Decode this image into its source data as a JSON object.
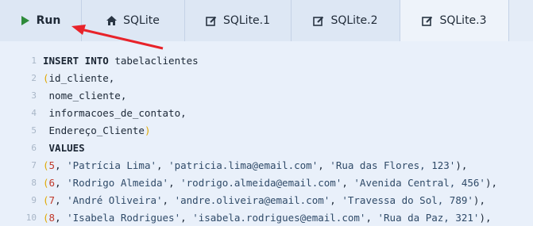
{
  "tabs": {
    "run": {
      "label": "Run",
      "icon": "play-icon"
    },
    "items": [
      {
        "label": "SQLite",
        "icon": "home-icon"
      },
      {
        "label": "SQLite.1",
        "icon": "edit-icon"
      },
      {
        "label": "SQLite.2",
        "icon": "edit-icon"
      },
      {
        "label": "SQLite.3",
        "icon": "edit-icon",
        "active": true
      }
    ]
  },
  "colors": {
    "accent_run": "#2e8b3a",
    "arrow": "#e8232a"
  },
  "code": {
    "lines": [
      {
        "n": "1",
        "parts": [
          {
            "t": "INSERT INTO",
            "c": "kw"
          },
          {
            "t": " tabelaclientes",
            "c": ""
          }
        ]
      },
      {
        "n": "2",
        "parts": [
          {
            "t": "(",
            "c": "paren"
          },
          {
            "t": "id_cliente,",
            "c": ""
          }
        ]
      },
      {
        "n": "3",
        "parts": [
          {
            "t": " nome_cliente,",
            "c": ""
          }
        ]
      },
      {
        "n": "4",
        "parts": [
          {
            "t": " informacoes_de_contato,",
            "c": ""
          }
        ]
      },
      {
        "n": "5",
        "parts": [
          {
            "t": " Endereço_Cliente",
            "c": ""
          },
          {
            "t": ")",
            "c": "paren"
          }
        ]
      },
      {
        "n": "6",
        "parts": [
          {
            "t": " VALUES",
            "c": "kw"
          }
        ]
      },
      {
        "n": "7",
        "parts": [
          {
            "t": "(",
            "c": "paren"
          },
          {
            "t": "5",
            "c": "num"
          },
          {
            "t": ", ",
            "c": ""
          },
          {
            "t": "'Patrícia Lima'",
            "c": "str"
          },
          {
            "t": ", ",
            "c": ""
          },
          {
            "t": "'patricia.lima@email.com'",
            "c": "str"
          },
          {
            "t": ", ",
            "c": ""
          },
          {
            "t": "'Rua das Flores, 123'",
            "c": "str"
          },
          {
            "t": "),",
            "c": ""
          }
        ]
      },
      {
        "n": "8",
        "parts": [
          {
            "t": "(",
            "c": "paren"
          },
          {
            "t": "6",
            "c": "num"
          },
          {
            "t": ", ",
            "c": ""
          },
          {
            "t": "'Rodrigo Almeida'",
            "c": "str"
          },
          {
            "t": ", ",
            "c": ""
          },
          {
            "t": "'rodrigo.almeida@email.com'",
            "c": "str"
          },
          {
            "t": ", ",
            "c": ""
          },
          {
            "t": "'Avenida Central, 456'",
            "c": "str"
          },
          {
            "t": "),",
            "c": ""
          }
        ]
      },
      {
        "n": "9",
        "parts": [
          {
            "t": "(",
            "c": "paren"
          },
          {
            "t": "7",
            "c": "num"
          },
          {
            "t": ", ",
            "c": ""
          },
          {
            "t": "'André Oliveira'",
            "c": "str"
          },
          {
            "t": ", ",
            "c": ""
          },
          {
            "t": "'andre.oliveira@email.com'",
            "c": "str"
          },
          {
            "t": ", ",
            "c": ""
          },
          {
            "t": "'Travessa do Sol, 789'",
            "c": "str"
          },
          {
            "t": "),",
            "c": ""
          }
        ]
      },
      {
        "n": "10",
        "parts": [
          {
            "t": "(",
            "c": "paren"
          },
          {
            "t": "8",
            "c": "num"
          },
          {
            "t": ", ",
            "c": ""
          },
          {
            "t": "'Isabela Rodrigues'",
            "c": "str"
          },
          {
            "t": ", ",
            "c": ""
          },
          {
            "t": "'isabela.rodrigues@email.com'",
            "c": "str"
          },
          {
            "t": ", ",
            "c": ""
          },
          {
            "t": "'Rua da Paz, 321'",
            "c": "str"
          },
          {
            "t": "),",
            "c": ""
          }
        ]
      }
    ]
  }
}
